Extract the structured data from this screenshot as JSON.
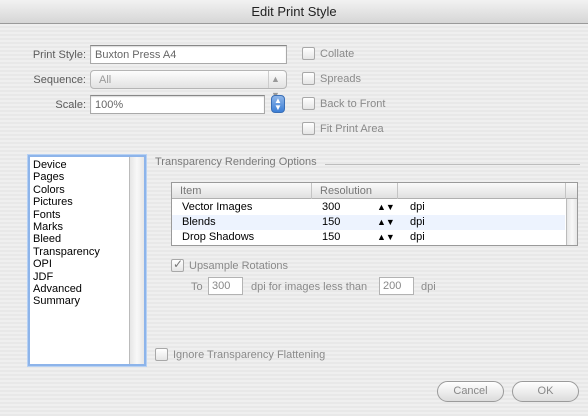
{
  "window": {
    "title": "Edit Print Style"
  },
  "form": {
    "print_style_label": "Print Style:",
    "print_style_value": "Buxton Press A4",
    "sequence_label": "Sequence:",
    "sequence_value": "All",
    "scale_label": "Scale:",
    "scale_value": "100%"
  },
  "options": {
    "collate": "Collate",
    "spreads": "Spreads",
    "back_to_front": "Back to Front",
    "fit_print_area": "Fit Print Area"
  },
  "sidebar": {
    "items": [
      "Device",
      "Pages",
      "Colors",
      "Pictures",
      "Fonts",
      "Marks",
      "Bleed",
      "Transparency",
      "OPI",
      "JDF",
      "Advanced",
      "Summary"
    ]
  },
  "transparency": {
    "section_title": "Transparency Rendering Options",
    "columns": [
      "Item",
      "Resolution"
    ],
    "rows": [
      {
        "item": "Vector Images",
        "resolution": "300",
        "unit": "dpi"
      },
      {
        "item": "Blends",
        "resolution": "150",
        "unit": "dpi"
      },
      {
        "item": "Drop Shadows",
        "resolution": "150",
        "unit": "dpi"
      }
    ],
    "upsample_label": "Upsample Rotations",
    "upsample_checked": true,
    "to_label": "To",
    "to_value": "300",
    "dpi_for_label": "dpi for images less than",
    "less_than_value": "200",
    "dpi_label": "dpi",
    "ignore_label": "Ignore Transparency Flattening"
  },
  "buttons": {
    "cancel": "Cancel",
    "ok": "OK"
  },
  "icons": {
    "popup_arrows": "↕",
    "stepper": "stepper-icon",
    "checkmark": "✓",
    "row_arrows": "↕"
  }
}
